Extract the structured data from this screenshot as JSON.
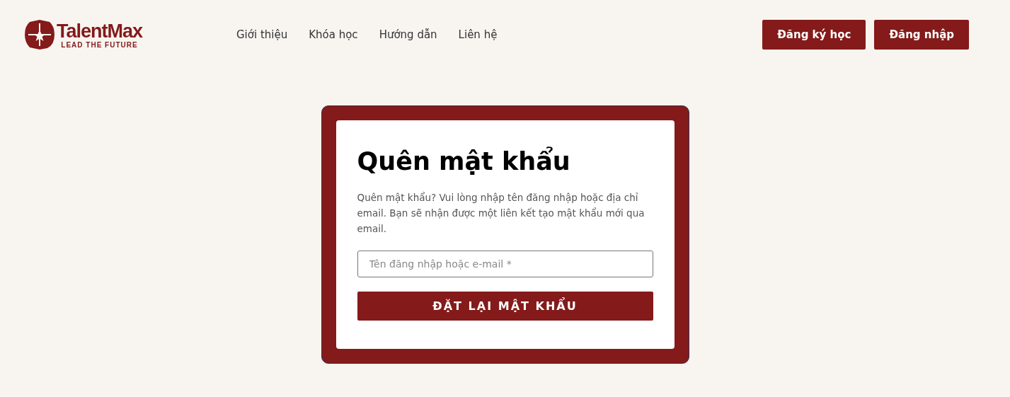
{
  "header": {
    "logo": {
      "name": "TalentMax",
      "tagline": "LEAD THE FUTURE"
    },
    "nav": [
      "Giới thiệu",
      "Khóa học",
      "Hướng dẫn",
      "Liên hệ"
    ],
    "buttons": [
      "Đăng ký học",
      "Đăng nhập"
    ]
  },
  "form": {
    "title": "Quên mật khẩu",
    "description": "Quên mật khẩu? Vui lòng nhập tên đăng nhập hoặc địa chỉ email. Bạn sẽ nhận được một liên kết tạo mật khẩu mới qua email.",
    "field": {
      "placeholder": "Tên đăng nhập hoặc e-mail *"
    },
    "submit": "ĐẶT LẠI MẬT KHẨU"
  }
}
